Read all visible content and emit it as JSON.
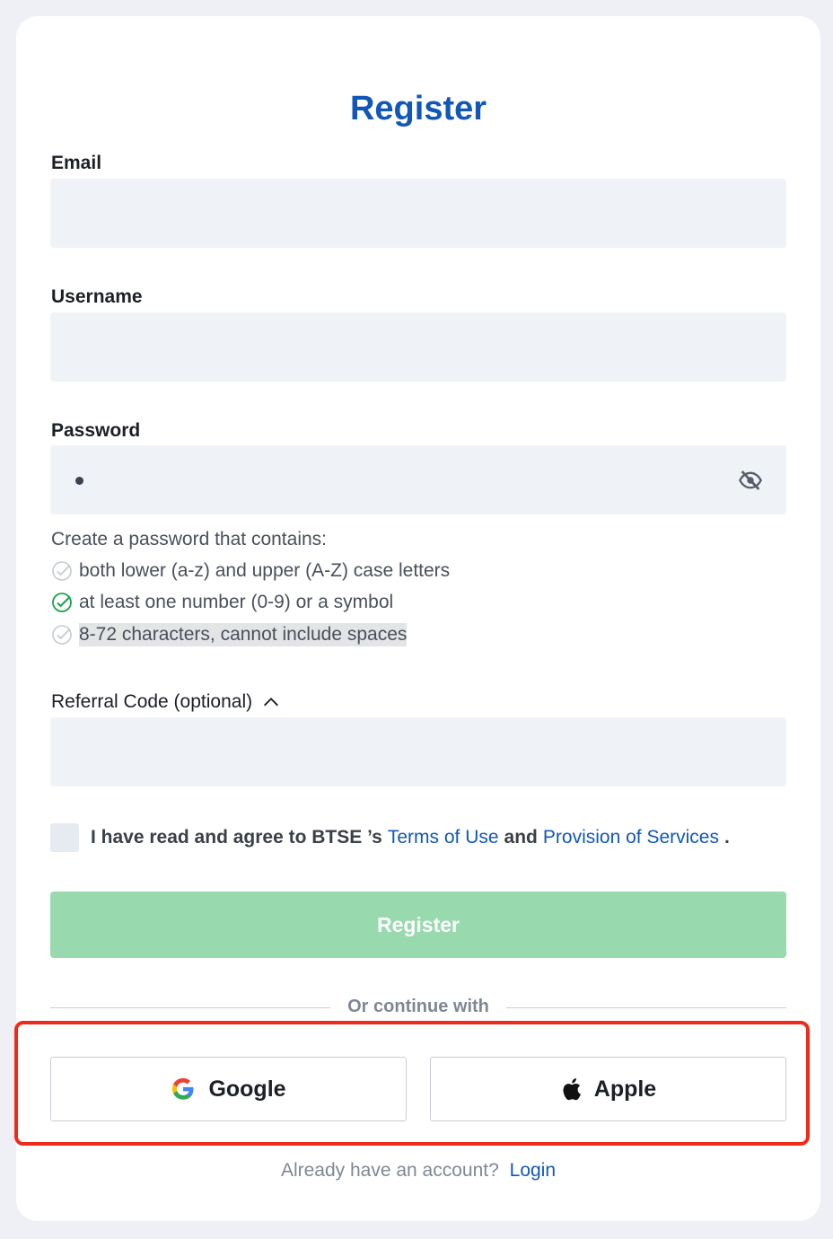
{
  "form": {
    "title": "Register",
    "email_label": "Email",
    "email_value": "",
    "username_label": "Username",
    "username_value": "",
    "password_label": "Password",
    "password_rules_intro": "Create a password that contains:",
    "password_rules": [
      {
        "text": "both lower (a-z) and upper (A-Z) case letters",
        "met": false
      },
      {
        "text": "at least one number (0-9) or a symbol",
        "met": true
      },
      {
        "text": "8-72 characters, cannot include spaces",
        "met": false
      }
    ],
    "referral_label": "Referral Code (optional)",
    "referral_value": "",
    "agree_prefix": "I have read and agree to BTSE ’s",
    "terms_link": "Terms of Use",
    "agree_and": "and",
    "provision_link": "Provision of Services",
    "agree_suffix": ".",
    "register_button": "Register"
  },
  "social": {
    "divider_text": "Or continue with",
    "google_label": "Google",
    "apple_label": "Apple"
  },
  "footer": {
    "prompt": "Already have an account?",
    "login_link": "Login"
  },
  "colors": {
    "brand_blue": "#1257b8",
    "register_disabled": "#98d9ae",
    "check_met": "#1aa34a",
    "highlight": "#ee2a1b"
  }
}
